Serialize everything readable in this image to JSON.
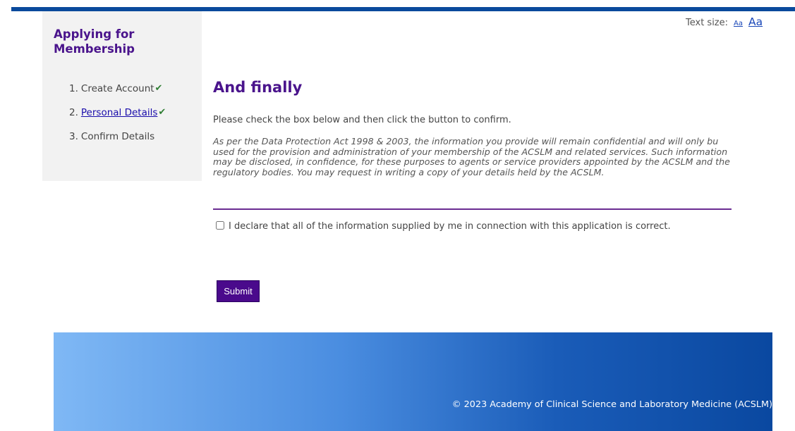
{
  "sidebar": {
    "title": "Applying for Membership",
    "steps": [
      {
        "number": "1.",
        "label": "Create Account",
        "completed": true,
        "link": false
      },
      {
        "number": "2.",
        "label": "Personal Details",
        "completed": true,
        "link": true
      },
      {
        "number": "3.",
        "label": "Confirm Details",
        "completed": false,
        "link": false
      }
    ]
  },
  "text_size": {
    "label": "Text size:",
    "small_label": "Aa",
    "large_label": "Aa"
  },
  "main": {
    "heading": "And finally",
    "instruction": "Please check the box below and then click the button to confirm.",
    "privacy_notice": "As per the Data Protection Act 1998 & 2003, the information you provide will remain confidential and will only bu used for the provision and administration of your membership of the ACSLM and related services. Such information may be disclosed, in confidence, for these purposes to agents or service providers appointed by the ACSLM and the regulatory bodies. You may request in writing a copy of your details held by the ACSLM.",
    "declaration": "I declare that all of the information supplied by me in connection with this application is correct.",
    "declaration_checked": false,
    "submit_label": "Submit"
  },
  "footer": {
    "copyright": "© 2023 Academy of Clinical Science and Laboratory Medicine (ACSLM)"
  },
  "colors": {
    "accent_purple": "#4a148c",
    "top_bar": "#0a4a9c",
    "check_green": "#2e7d32"
  }
}
